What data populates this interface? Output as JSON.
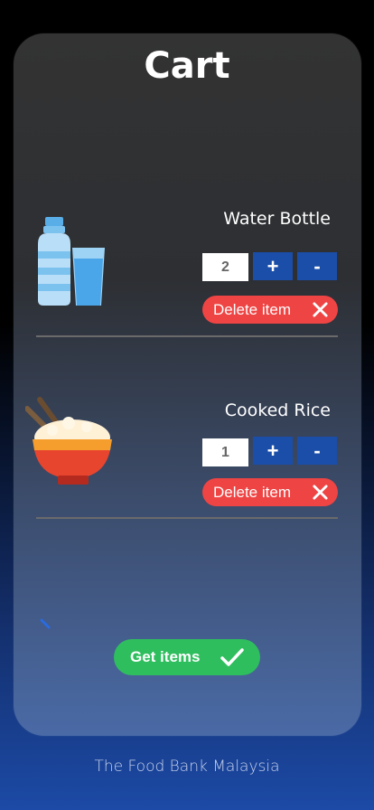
{
  "header": {
    "title": "Cart"
  },
  "cart": {
    "items": [
      {
        "name": "Water Bottle",
        "quantity": "2",
        "plus_label": "+",
        "minus_label": "-",
        "delete_label": "Delete item",
        "icon": "water-bottle-icon"
      },
      {
        "name": "Cooked Rice",
        "quantity": "1",
        "plus_label": "+",
        "minus_label": "-",
        "delete_label": "Delete item",
        "icon": "rice-bowl-icon"
      }
    ],
    "get_items_label": "Get items"
  },
  "footer": {
    "text": "The Food Bank Malaysia"
  },
  "colors": {
    "accent_blue": "#1a4ea8",
    "delete_red": "#ef4444",
    "confirm_green": "#2fbe5e"
  }
}
